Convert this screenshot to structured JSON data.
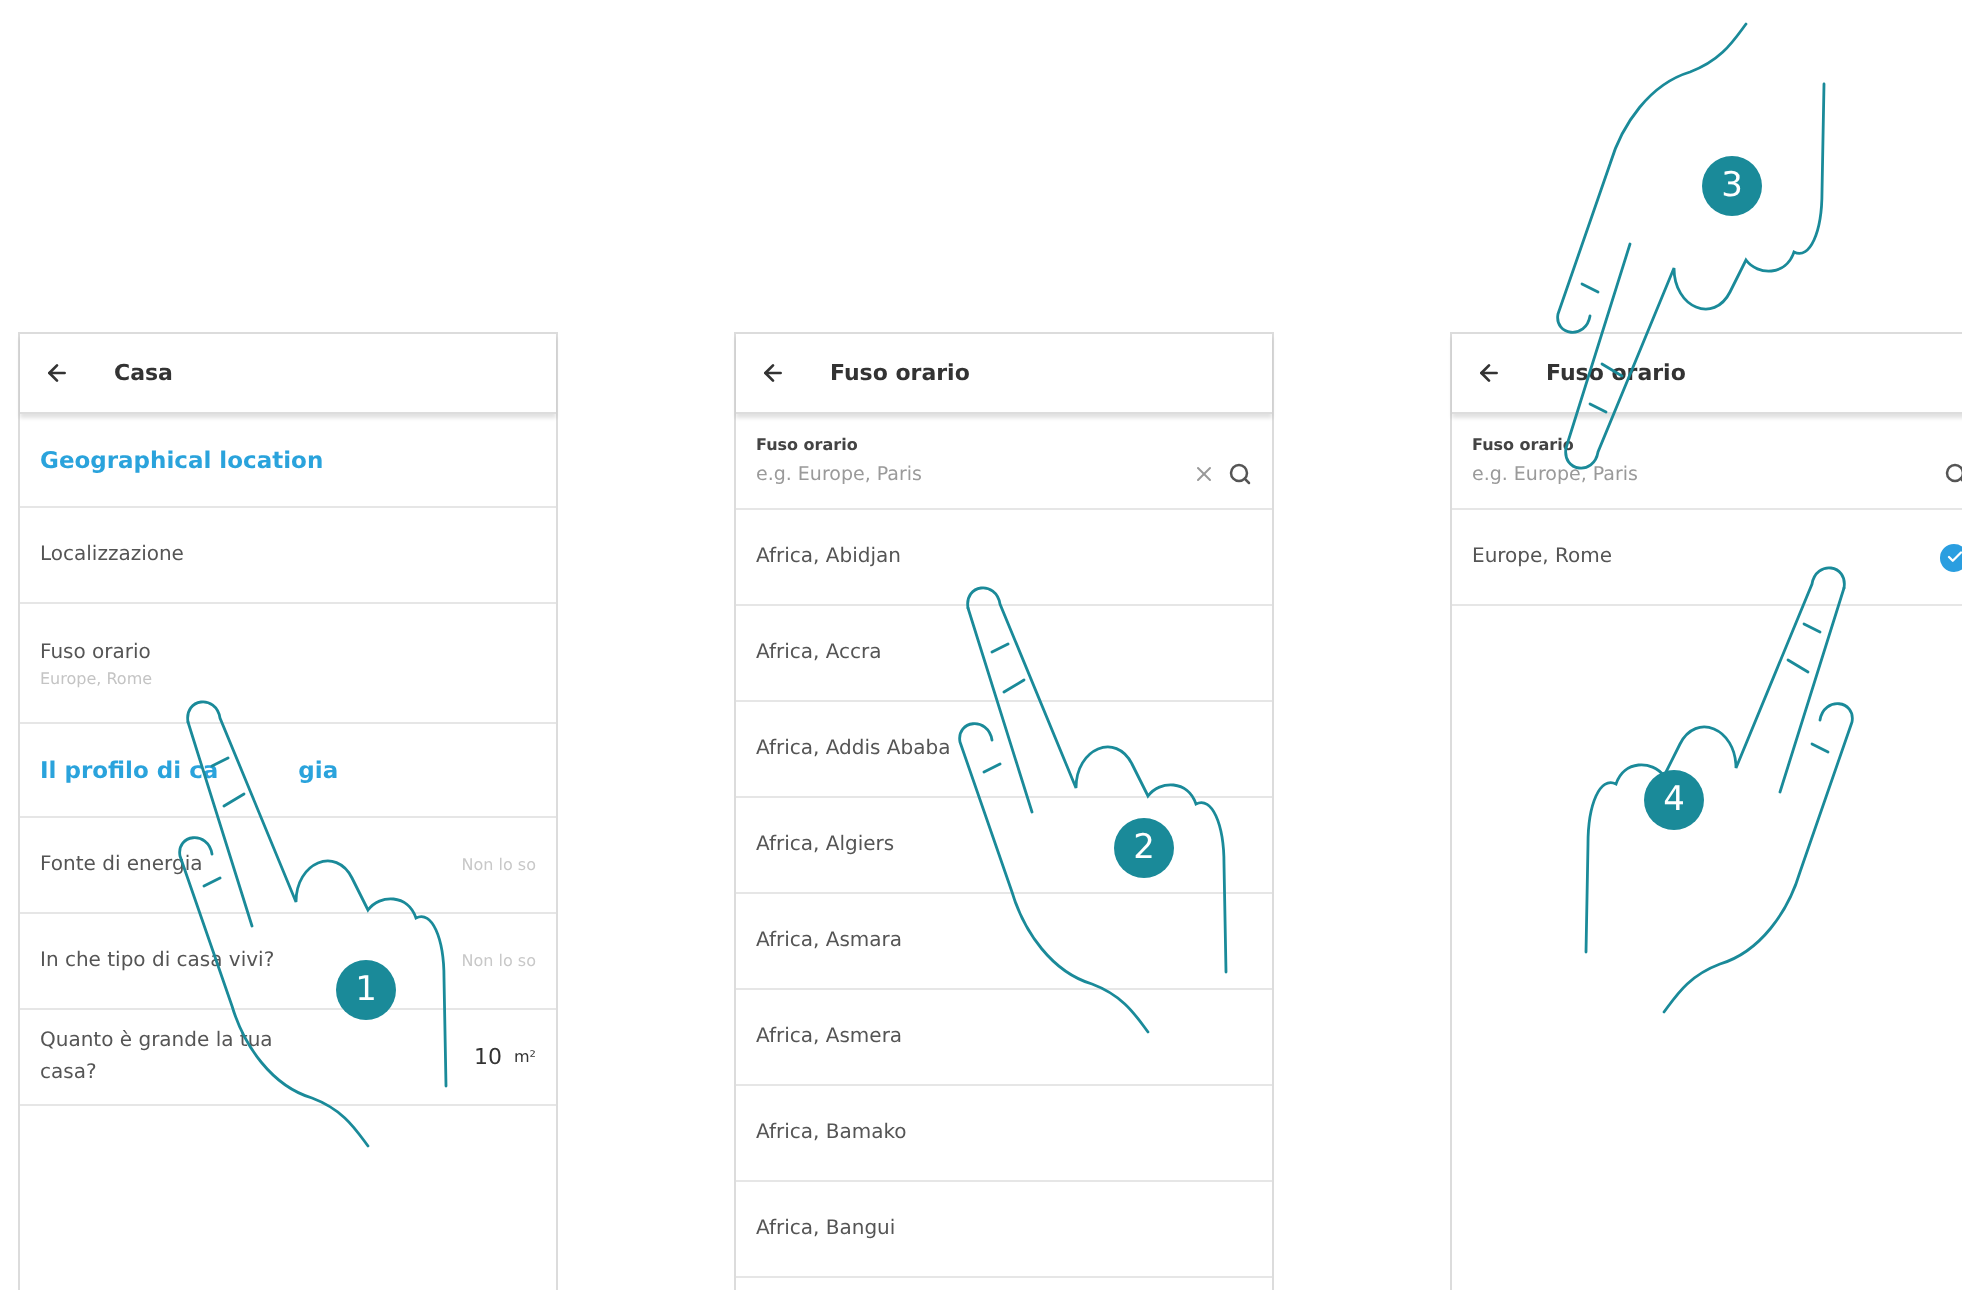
{
  "screens": [
    {
      "kind": "settings",
      "title": "Casa",
      "rows": [
        {
          "kind": "section",
          "label": "Geographical location"
        },
        {
          "kind": "item",
          "label": "Localizzazione"
        },
        {
          "kind": "item",
          "label": "Fuso orario",
          "sub": "Europe, Rome"
        },
        {
          "kind": "section",
          "label": "Il profilo di ca",
          "label_rest": "gia"
        },
        {
          "kind": "item",
          "label": "Fonte di energia",
          "value": "Non lo so"
        },
        {
          "kind": "item",
          "label": "In che tipo di casa vivi?",
          "value": "Non lo so"
        },
        {
          "kind": "item",
          "label": "Quanto è grande la tua casa?",
          "value": "10",
          "unit": "m²"
        }
      ]
    },
    {
      "kind": "search",
      "title": "Fuso orario",
      "field_label": "Fuso orario",
      "placeholder": "e.g. Europe, Paris",
      "clear": true,
      "results": [
        {
          "label": "Africa, Abidjan",
          "selected": false
        },
        {
          "label": "Africa, Accra",
          "selected": false
        },
        {
          "label": "Africa, Addis Ababa",
          "selected": false
        },
        {
          "label": "Africa, Algiers",
          "selected": false
        },
        {
          "label": "Africa, Asmara",
          "selected": false
        },
        {
          "label": "Africa, Asmera",
          "selected": false
        },
        {
          "label": "Africa, Bamako",
          "selected": false
        },
        {
          "label": "Africa, Bangui",
          "selected": false
        }
      ]
    },
    {
      "kind": "search",
      "title": "Fuso orario",
      "field_label": "Fuso orario",
      "placeholder": "e.g. Europe, Paris",
      "clear": false,
      "results": [
        {
          "label": "Europe, Rome",
          "selected": true
        }
      ]
    }
  ],
  "steps": [
    "1",
    "2",
    "3",
    "4"
  ]
}
